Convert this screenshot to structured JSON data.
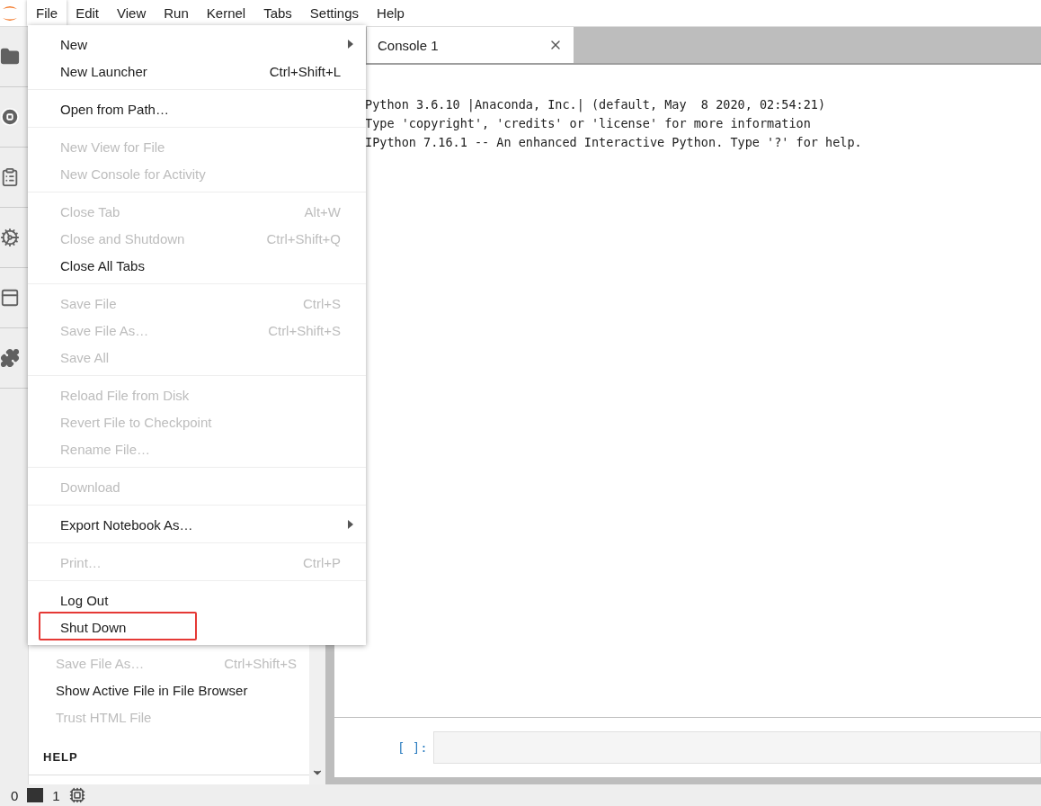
{
  "menubar": {
    "items": [
      {
        "label": "File",
        "selected": true
      },
      {
        "label": "Edit",
        "selected": false
      },
      {
        "label": "View",
        "selected": false
      },
      {
        "label": "Run",
        "selected": false
      },
      {
        "label": "Kernel",
        "selected": false
      },
      {
        "label": "Tabs",
        "selected": false
      },
      {
        "label": "Settings",
        "selected": false
      },
      {
        "label": "Help",
        "selected": false
      }
    ]
  },
  "file_menu": {
    "sections": [
      [
        {
          "label": "New",
          "disabled": false,
          "submenu": true,
          "highlighted": false
        },
        {
          "label": "New Launcher",
          "shortcut": "Ctrl+Shift+L",
          "disabled": false,
          "submenu": false,
          "highlighted": false
        }
      ],
      [
        {
          "label": "Open from Path…",
          "disabled": false,
          "submenu": false,
          "highlighted": false
        }
      ],
      [
        {
          "label": "New View for File",
          "disabled": true,
          "submenu": false,
          "highlighted": false
        },
        {
          "label": "New Console for Activity",
          "disabled": true,
          "submenu": false,
          "highlighted": false
        }
      ],
      [
        {
          "label": "Close Tab",
          "shortcut": "Alt+W",
          "disabled": true,
          "submenu": false,
          "highlighted": false
        },
        {
          "label": "Close and Shutdown",
          "shortcut": "Ctrl+Shift+Q",
          "disabled": true,
          "submenu": false,
          "highlighted": false
        },
        {
          "label": "Close All Tabs",
          "disabled": false,
          "submenu": false,
          "highlighted": false
        }
      ],
      [
        {
          "label": "Save File",
          "shortcut": "Ctrl+S",
          "disabled": true,
          "submenu": false,
          "highlighted": false
        },
        {
          "label": "Save File As…",
          "shortcut": "Ctrl+Shift+S",
          "disabled": true,
          "submenu": false,
          "highlighted": false
        },
        {
          "label": "Save All",
          "disabled": true,
          "submenu": false,
          "highlighted": false
        }
      ],
      [
        {
          "label": "Reload File from Disk",
          "disabled": true,
          "submenu": false,
          "highlighted": false
        },
        {
          "label": "Revert File to Checkpoint",
          "disabled": true,
          "submenu": false,
          "highlighted": false
        },
        {
          "label": "Rename File…",
          "disabled": true,
          "submenu": false,
          "highlighted": false
        }
      ],
      [
        {
          "label": "Download",
          "disabled": true,
          "submenu": false,
          "highlighted": false
        }
      ],
      [
        {
          "label": "Export Notebook As…",
          "disabled": false,
          "submenu": true,
          "highlighted": false
        }
      ],
      [
        {
          "label": "Print…",
          "shortcut": "Ctrl+P",
          "disabled": true,
          "submenu": false,
          "highlighted": false
        }
      ],
      [
        {
          "label": "Log Out",
          "disabled": false,
          "submenu": false,
          "highlighted": false
        },
        {
          "label": "Shut Down",
          "disabled": false,
          "submenu": false,
          "highlighted": true
        }
      ]
    ]
  },
  "command_panel": {
    "items": [
      {
        "label": "Save File As…",
        "shortcut": "Ctrl+Shift+S",
        "disabled": true
      },
      {
        "label": "Show Active File in File Browser",
        "disabled": false
      },
      {
        "label": "Trust HTML File",
        "disabled": true
      }
    ],
    "section": "HELP"
  },
  "tabs": [
    {
      "label": "Console 1",
      "selected": true
    }
  ],
  "console": {
    "output": [
      "Python 3.6.10 |Anaconda, Inc.| (default, May  8 2020, 02:54:21)",
      "Type 'copyright', 'credits' or 'license' for more information",
      "IPython 7.16.1 -- An enhanced Interactive Python. Type '?' for help."
    ],
    "prompt": "[ ]:"
  },
  "status_bar": {
    "kernels": "0",
    "terminals": "1"
  }
}
